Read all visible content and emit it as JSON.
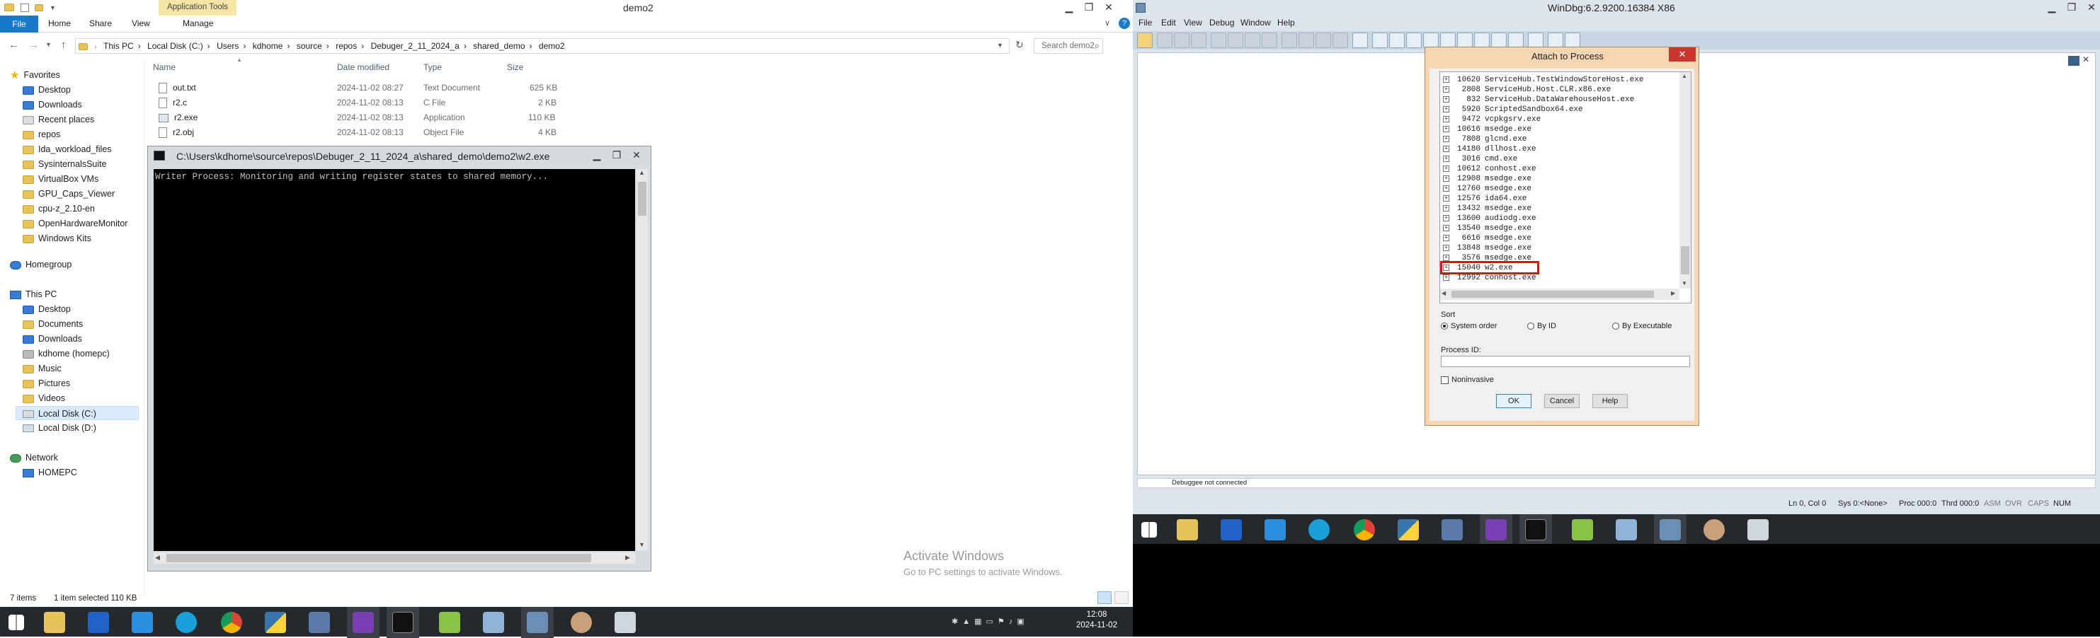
{
  "explorer": {
    "ribbon_context_tab": "Application Tools",
    "title": "demo2",
    "tabs": [
      "File",
      "Home",
      "Share",
      "View",
      "Manage"
    ],
    "breadcrumb": [
      "This PC",
      "Local Disk (C:)",
      "Users",
      "kdhome",
      "source",
      "repos",
      "Debuger_2_11_2024_a",
      "shared_demo",
      "demo2"
    ],
    "search_placeholder": "Search demo2",
    "columns": {
      "name": "Name",
      "date": "Date modified",
      "type": "Type",
      "size": "Size"
    },
    "files": [
      {
        "name": "out.txt",
        "date": "2024-11-02 08:27",
        "type": "Text Document",
        "size": "625 KB"
      },
      {
        "name": "r2.c",
        "date": "2024-11-02 08:13",
        "type": "C File",
        "size": "2 KB"
      },
      {
        "name": "r2.exe",
        "date": "2024-11-02 08:13",
        "type": "Application",
        "size": "110 KB"
      },
      {
        "name": "r2.obj",
        "date": "2024-11-02 08:13",
        "type": "Object File",
        "size": "4 KB"
      }
    ],
    "nav": {
      "favorites_label": "Favorites",
      "favorites": [
        "Desktop",
        "Downloads",
        "Recent places",
        "repos",
        "Ida_workload_files",
        "SysinternalsSuite",
        "VirtualBox VMs",
        "GPU_Caps_Viewer",
        "cpu-z_2.10-en",
        "OpenHardwareMonitor",
        "Windows Kits"
      ],
      "homegroup": "Homegroup",
      "thispc_label": "This PC",
      "thispc": [
        "Desktop",
        "Documents",
        "Downloads",
        "kdhome (homepc)",
        "Music",
        "Pictures",
        "Videos",
        "Local Disk (C:)",
        "Local Disk (D:)"
      ],
      "network_label": "Network",
      "network": [
        "HOMEPC"
      ]
    },
    "status": {
      "items": "7 items",
      "selected": "1 item selected  110 KB"
    }
  },
  "console": {
    "title": "C:\\Users\\kdhome\\source\\repos\\Debuger_2_11_2024_a\\shared_demo\\demo2\\w2.exe",
    "output": "Writer Process: Monitoring and writing register states to shared memory..."
  },
  "watermark": {
    "title": "Activate Windows",
    "subtitle": "Go to PC settings to activate Windows."
  },
  "windbg": {
    "title": "WinDbg:6.2.9200.16384 X86",
    "menu": [
      "File",
      "Edit",
      "View",
      "Debug",
      "Window",
      "Help"
    ],
    "status_text": "Debuggee not connected",
    "statusbar": [
      "Ln 0, Col 0",
      "Sys 0:<None>",
      "Proc 000:0",
      "Thrd 000:0",
      "ASM",
      "OVR",
      "CAPS",
      "NUM"
    ]
  },
  "dialog": {
    "title": "Attach to Process",
    "processes": [
      {
        "pid": "10620",
        "name": "ServiceHub.TestWindowStoreHost.exe"
      },
      {
        "pid": "2808",
        "name": "ServiceHub.Host.CLR.x86.exe"
      },
      {
        "pid": "832",
        "name": "ServiceHub.DataWarehouseHost.exe"
      },
      {
        "pid": "5920",
        "name": "ScriptedSandbox64.exe"
      },
      {
        "pid": "9472",
        "name": "vcpkgsrv.exe"
      },
      {
        "pid": "10616",
        "name": "msedge.exe"
      },
      {
        "pid": "7808",
        "name": "glcnd.exe"
      },
      {
        "pid": "14180",
        "name": "dllhost.exe"
      },
      {
        "pid": "3016",
        "name": "cmd.exe"
      },
      {
        "pid": "10612",
        "name": "conhost.exe"
      },
      {
        "pid": "12908",
        "name": "msedge.exe"
      },
      {
        "pid": "12760",
        "name": "msedge.exe"
      },
      {
        "pid": "12576",
        "name": "ida64.exe"
      },
      {
        "pid": "13432",
        "name": "msedge.exe"
      },
      {
        "pid": "13600",
        "name": "audiodg.exe"
      },
      {
        "pid": "13540",
        "name": "msedge.exe"
      },
      {
        "pid": "6616",
        "name": "msedge.exe"
      },
      {
        "pid": "13848",
        "name": "msedge.exe"
      },
      {
        "pid": "3576",
        "name": "msedge.exe"
      },
      {
        "pid": "15040",
        "name": "w2.exe"
      },
      {
        "pid": "12992",
        "name": "conhost.exe"
      }
    ],
    "highlighted_index": 19,
    "sort_label": "Sort",
    "sort_options": [
      "System order",
      "By ID",
      "By Executable"
    ],
    "sort_selected": 0,
    "pid_label": "Process ID:",
    "pid_value": "",
    "noninvasive_label": "Noninvasive",
    "noninvasive_checked": false,
    "buttons": {
      "ok": "OK",
      "cancel": "Cancel",
      "help": "Help"
    }
  },
  "taskbar_left": {
    "apps": [
      "start-button",
      "file-explorer-icon",
      "app-blue-icon",
      "search-magnifier-icon",
      "edge-icon",
      "chrome-icon",
      "python-icon",
      "network-tool-icon",
      "visual-studio-icon",
      "cmd-icon",
      "notepadpp-icon",
      "paint-icon",
      "windbg-icon",
      "character-app-icon",
      "app-terminal-icon"
    ],
    "clock_time": "12:08",
    "clock_date": "2024-11-02"
  },
  "taskbar_right": {
    "apps": [
      "start-button",
      "file-explorer-icon",
      "app-blue-icon",
      "search-magnifier-icon",
      "edge-icon",
      "chrome-icon",
      "python-icon",
      "network-tool-icon",
      "visual-studio-icon",
      "cmd-icon",
      "notepadpp-icon",
      "paint-icon",
      "windbg-icon",
      "character-app-icon",
      "app-terminal-icon"
    ]
  },
  "colors": {
    "explorer_file_tab": "#1979ca",
    "context_tab": "#f5e6a8",
    "taskbar": "#25282c",
    "console_bg": "#000000",
    "console_text": "#c0c0c0",
    "dialog_bg": "#f4d6b3",
    "highlight_box": "#e01010",
    "windbg_frame": "#dde4eb"
  }
}
